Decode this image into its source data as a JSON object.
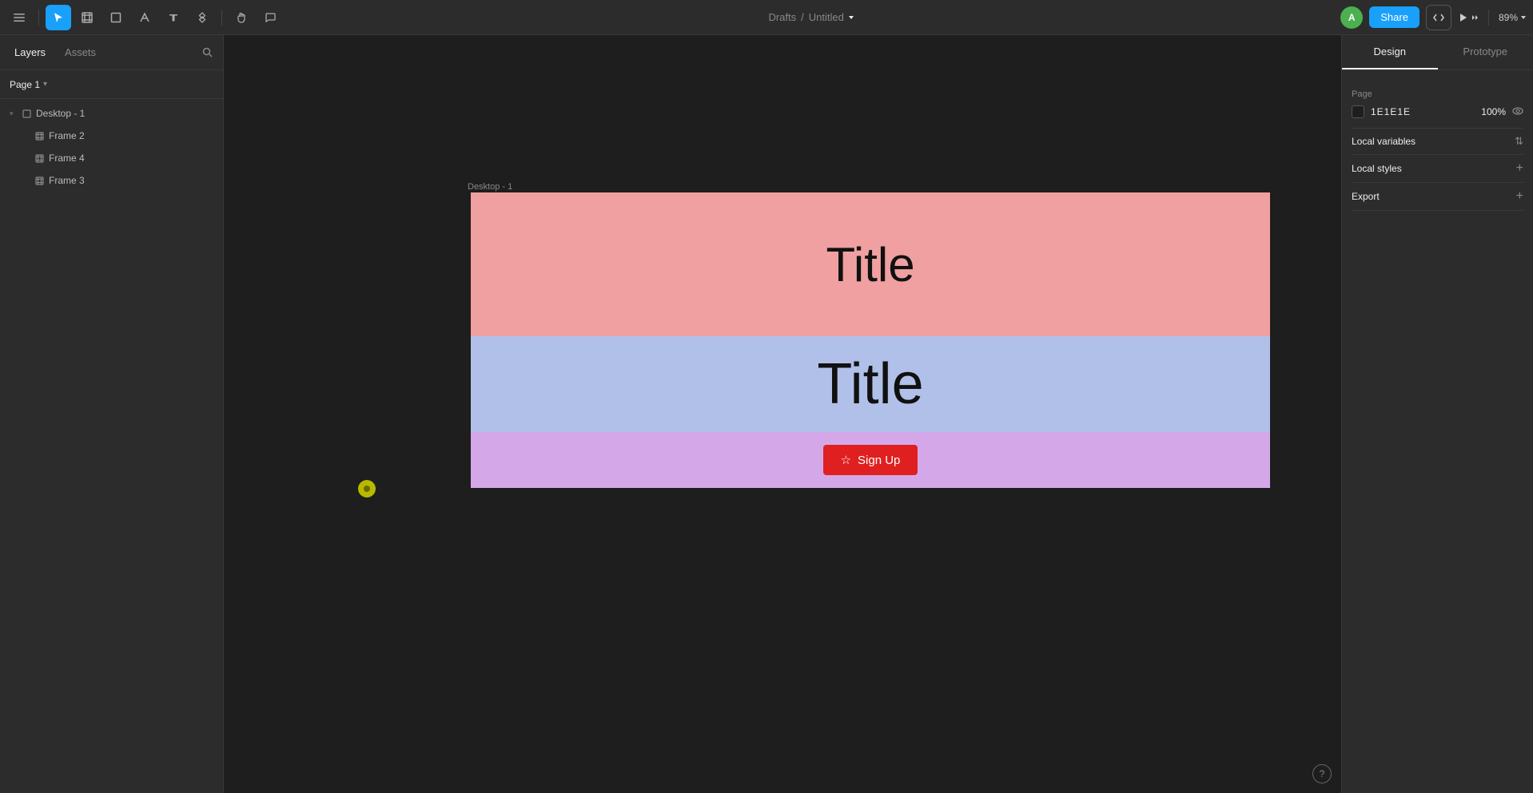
{
  "app": {
    "title": "Untitled",
    "breadcrumb_prefix": "Drafts",
    "breadcrumb_sep": "/",
    "zoom": "89%"
  },
  "toolbar": {
    "tools": [
      {
        "id": "menu",
        "icon": "☰",
        "active": false
      },
      {
        "id": "select",
        "icon": "↖",
        "active": true
      },
      {
        "id": "frame",
        "icon": "⊞",
        "active": false
      },
      {
        "id": "shapes",
        "icon": "□",
        "active": false
      },
      {
        "id": "pen",
        "icon": "✒",
        "active": false
      },
      {
        "id": "text",
        "icon": "T",
        "active": false
      },
      {
        "id": "components",
        "icon": "⁂",
        "active": false
      },
      {
        "id": "hand",
        "icon": "✋",
        "active": false
      },
      {
        "id": "comment",
        "icon": "💬",
        "active": false
      }
    ],
    "share_label": "Share",
    "avatar_initial": "A",
    "play_icon": "▶",
    "chevron_down": "⌄"
  },
  "left_panel": {
    "tabs": [
      {
        "id": "layers",
        "label": "Layers",
        "active": true
      },
      {
        "id": "assets",
        "label": "Assets",
        "active": false
      }
    ],
    "page_label": "Page 1",
    "layers": [
      {
        "id": "desktop1",
        "label": "Desktop - 1",
        "indent": 0,
        "icon": "☰",
        "expanded": true
      },
      {
        "id": "frame2",
        "label": "Frame 2",
        "indent": 1,
        "icon": "⊞"
      },
      {
        "id": "frame4",
        "label": "Frame 4",
        "indent": 1,
        "icon": "⊞"
      },
      {
        "id": "frame3",
        "label": "Frame 3",
        "indent": 1,
        "icon": "⊞"
      }
    ]
  },
  "canvas": {
    "frame_label": "Desktop - 1",
    "frame1_title": "Title",
    "frame2_title": "Title",
    "signup_star": "☆",
    "signup_label": "Sign Up"
  },
  "right_panel": {
    "tabs": [
      {
        "id": "design",
        "label": "Design",
        "active": true
      },
      {
        "id": "prototype",
        "label": "Prototype",
        "active": false
      }
    ],
    "page_section_label": "Page",
    "page_color": "1E1E1E",
    "page_opacity": "100%",
    "local_variables_label": "Local variables",
    "local_variables_icon": "⇅",
    "local_styles_label": "Local styles",
    "add_icon": "+",
    "export_label": "Export",
    "help_label": "?"
  }
}
